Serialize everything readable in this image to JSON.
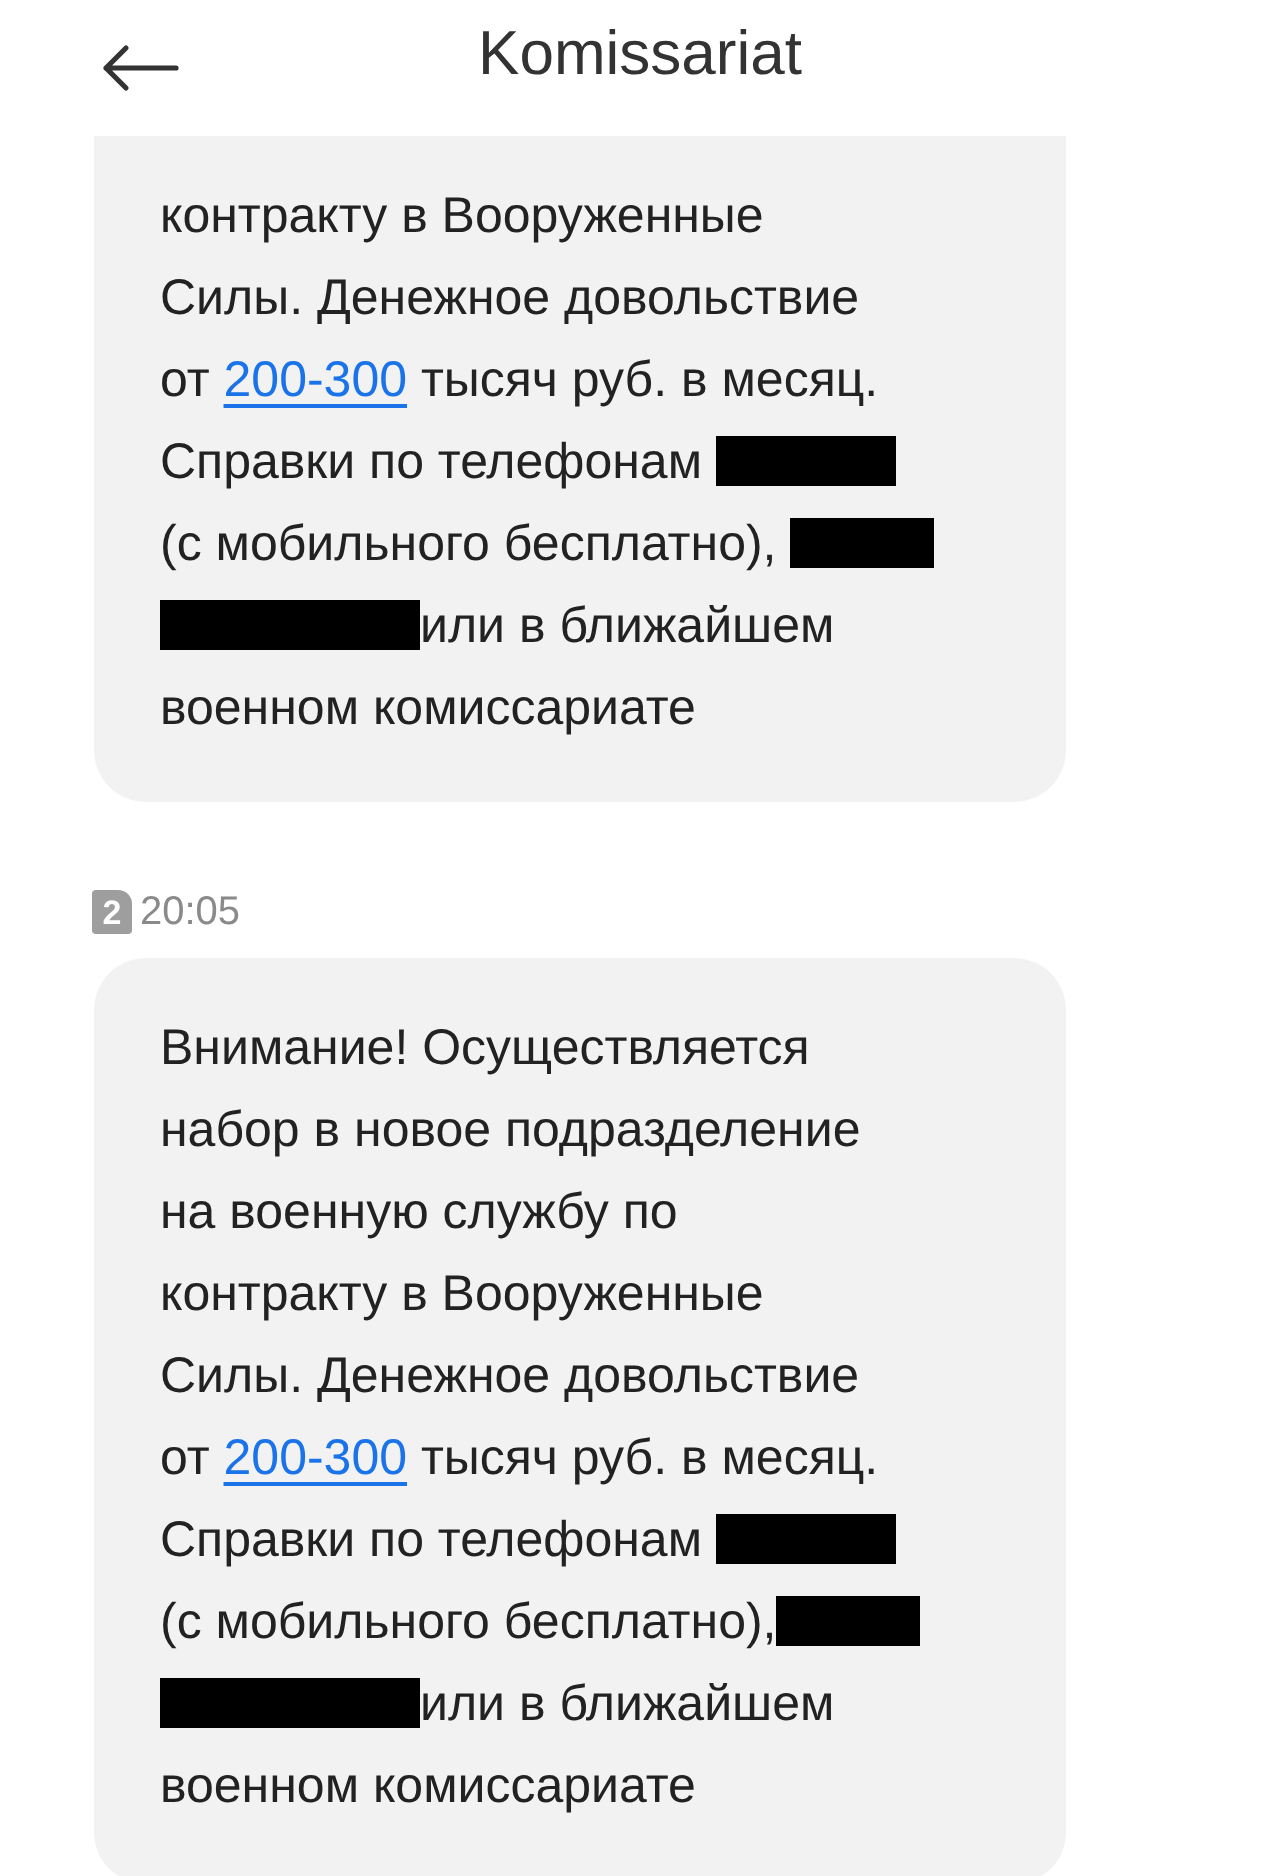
{
  "header": {
    "title": "Komissariat"
  },
  "messages": [
    {
      "cut_top": true,
      "segments": [
        {
          "kind": "text",
          "text": "контракту в Вооруженные"
        },
        {
          "kind": "break"
        },
        {
          "kind": "text",
          "text": "Силы. Денежное довольствие"
        },
        {
          "kind": "break"
        },
        {
          "kind": "text",
          "text": "от "
        },
        {
          "kind": "link",
          "text": "200-300"
        },
        {
          "kind": "text",
          "text": " тысяч руб. в месяц."
        },
        {
          "kind": "break"
        },
        {
          "kind": "text",
          "text": "Справки по телефонам "
        },
        {
          "kind": "redaction"
        },
        {
          "kind": "break"
        },
        {
          "kind": "text",
          "text": "(с мобильного бесплатно), "
        },
        {
          "kind": "redaction"
        },
        {
          "kind": "break"
        },
        {
          "kind": "redaction"
        },
        {
          "kind": "text",
          "text": "или в ближайшем"
        },
        {
          "kind": "break"
        },
        {
          "kind": "text",
          "text": "военном комиссариате"
        }
      ]
    },
    {
      "cut_top": false,
      "sim": "2",
      "time": "20:05",
      "segments": [
        {
          "kind": "text",
          "text": "Внимание! Осуществляется"
        },
        {
          "kind": "break"
        },
        {
          "kind": "text",
          "text": "набор в новое подразделение"
        },
        {
          "kind": "break"
        },
        {
          "kind": "text",
          "text": "на военную службу по"
        },
        {
          "kind": "break"
        },
        {
          "kind": "text",
          "text": "контракту в Вооруженные"
        },
        {
          "kind": "break"
        },
        {
          "kind": "text",
          "text": "Силы. Денежное довольствие"
        },
        {
          "kind": "break"
        },
        {
          "kind": "text",
          "text": "от "
        },
        {
          "kind": "link",
          "text": "200-300"
        },
        {
          "kind": "text",
          "text": " тысяч руб. в месяц."
        },
        {
          "kind": "break"
        },
        {
          "kind": "text",
          "text": "Справки по телефонам "
        },
        {
          "kind": "redaction"
        },
        {
          "kind": "break"
        },
        {
          "kind": "text",
          "text": "(с мобильного бесплатно),"
        },
        {
          "kind": "redaction"
        },
        {
          "kind": "break"
        },
        {
          "kind": "redaction"
        },
        {
          "kind": "text",
          "text": "или в ближайшем"
        },
        {
          "kind": "break"
        },
        {
          "kind": "text",
          "text": "военном комиссариате"
        }
      ]
    }
  ]
}
